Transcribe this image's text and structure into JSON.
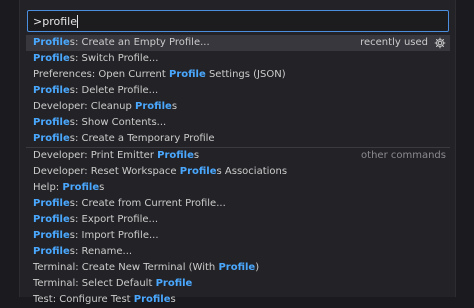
{
  "input": {
    "value": ">profile"
  },
  "items": [
    {
      "pre": "",
      "hl": "Profile",
      "mid": "s: Create an Empty Profile...",
      "hl2": "",
      "post": "",
      "right": "recently used"
    },
    {
      "pre": "",
      "hl": "Profile",
      "mid": "s: Switch Profile...",
      "hl2": "",
      "post": ""
    },
    {
      "pre": "Preferences: Open Current ",
      "hl": "Profile",
      "mid": " Settings (JSON)",
      "hl2": "",
      "post": ""
    },
    {
      "pre": "",
      "hl": "Profile",
      "mid": "s: Delete Profile...",
      "hl2": "",
      "post": ""
    },
    {
      "pre": "Developer: Cleanup ",
      "hl": "Profile",
      "mid": "s",
      "hl2": "",
      "post": ""
    },
    {
      "pre": "",
      "hl": "Profile",
      "mid": "s: Show Contents...",
      "hl2": "",
      "post": ""
    },
    {
      "pre": "",
      "hl": "Profile",
      "mid": "s: Create a Temporary Profile",
      "hl2": "",
      "post": ""
    },
    {
      "pre": "Developer: Print Emitter ",
      "hl": "Profile",
      "mid": "s",
      "hl2": "",
      "post": "",
      "right": "other commands",
      "sep": true
    },
    {
      "pre": "Developer: Reset Workspace ",
      "hl": "Profile",
      "mid": "s Associations",
      "hl2": "",
      "post": ""
    },
    {
      "pre": "Help: ",
      "hl": "Profile",
      "mid": "s",
      "hl2": "",
      "post": ""
    },
    {
      "pre": "",
      "hl": "Profile",
      "mid": "s: Create from Current Profile...",
      "hl2": "",
      "post": ""
    },
    {
      "pre": "",
      "hl": "Profile",
      "mid": "s: Export Profile...",
      "hl2": "",
      "post": ""
    },
    {
      "pre": "",
      "hl": "Profile",
      "mid": "s: Import Profile...",
      "hl2": "",
      "post": ""
    },
    {
      "pre": "",
      "hl": "Profile",
      "mid": "s: Rename...",
      "hl2": "",
      "post": ""
    },
    {
      "pre": "Terminal: Create New Terminal (With ",
      "hl": "Profile",
      "mid": ")",
      "hl2": "",
      "post": ""
    },
    {
      "pre": "Terminal: Select Default ",
      "hl": "Profile",
      "mid": "",
      "hl2": "",
      "post": ""
    },
    {
      "pre": "Test: Configure Test ",
      "hl": "Profile",
      "mid": "s",
      "hl2": "",
      "post": ""
    }
  ],
  "icons": {
    "configure": "gear-icon"
  },
  "colors": {
    "highlight": "#4aa8ff",
    "selected_bg": "#37373d",
    "focus_border": "#4b8ee0"
  }
}
